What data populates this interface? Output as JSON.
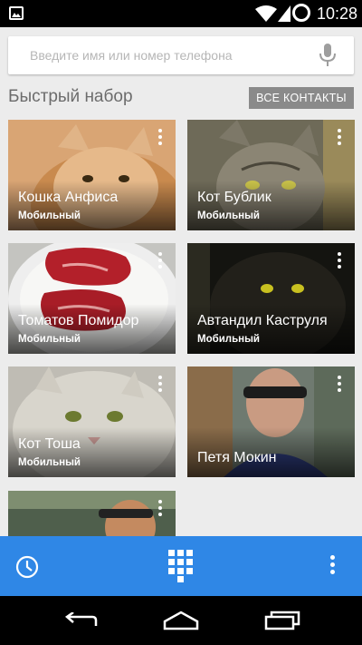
{
  "status_bar": {
    "time": "10:28"
  },
  "search": {
    "placeholder": "Введите имя или номер телефона"
  },
  "speed_dial": {
    "title": "Быстрый набор",
    "all_contacts_label": "ВСЕ КОНТАКТЫ"
  },
  "contacts": [
    {
      "name": "Кошка Анфиса",
      "type": "Мобильный"
    },
    {
      "name": "Кот Бублик",
      "type": "Мобильный"
    },
    {
      "name": "Томатов Помидор",
      "type": "Мобильный"
    },
    {
      "name": "Автандил Каструля",
      "type": "Мобильный"
    },
    {
      "name": "Кот Тоша",
      "type": "Мобильный"
    },
    {
      "name": "Петя Мокин",
      "type": ""
    },
    {
      "name": "",
      "type": ""
    }
  ],
  "colors": {
    "accent": "#2f87e6",
    "background": "#ececec",
    "button": "#8a8a8a"
  },
  "icons": {
    "call_history": "clock-icon",
    "dialpad": "dialpad-icon",
    "overflow": "more-vert-icon",
    "voice": "mic-icon"
  }
}
